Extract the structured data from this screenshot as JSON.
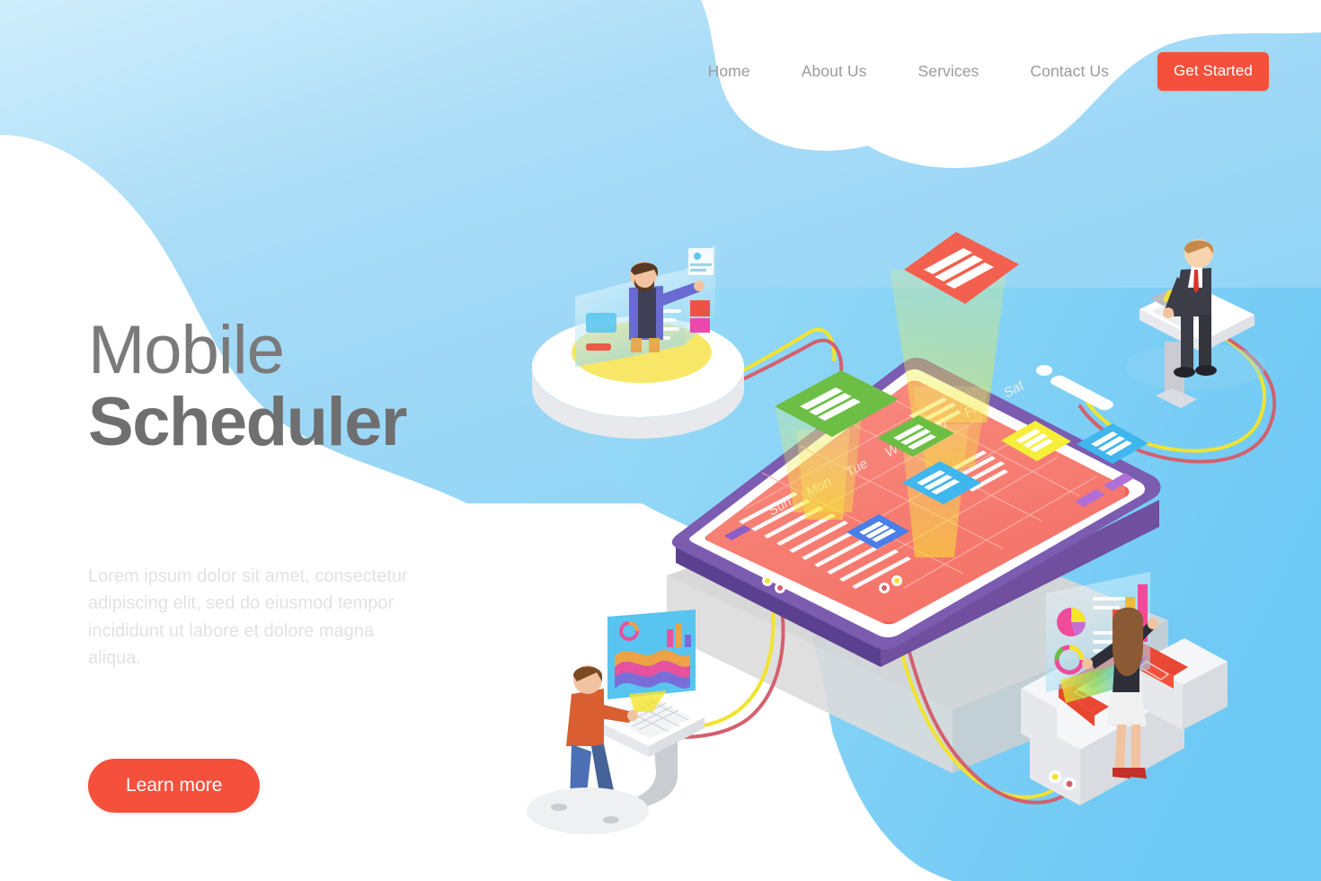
{
  "nav": {
    "links": [
      {
        "label": "Home"
      },
      {
        "label": "About Us"
      },
      {
        "label": "Services"
      },
      {
        "label": "Contact Us"
      }
    ],
    "cta_label": "Get Started",
    "cta_color": "#f4503c"
  },
  "hero": {
    "title_line1": "Mobile",
    "title_line2": "Scheduler",
    "paragraph": "Lorem ipsum dolor sit amet, consectetur adipiscing elit, sed do eiusmod tempor incididunt ut labore et dolore magna aliqua.",
    "cta_label": "Learn more",
    "cta_color": "#f4503c",
    "title_color": "#7a7a7a",
    "paragraph_color": "#e2e2e2"
  },
  "illustration": {
    "scene_name": "isometric-mobile-scheduler",
    "device": {
      "name": "smartphone",
      "frame_color": "#6f4f9e",
      "screen_color": "#f4604f",
      "screen_app": "calendar"
    },
    "calendar": {
      "day_labels": [
        "Sun",
        "Mon",
        "Tue",
        "Wen",
        "Thu",
        "Fri",
        "Sat"
      ],
      "event_cards": [
        {
          "color": "#6cbe45",
          "name": "green-event-card-large"
        },
        {
          "color": "#6cbe45",
          "name": "green-event-card-small"
        },
        {
          "color": "#3fb6ee",
          "name": "blue-event-card-center"
        },
        {
          "color": "#3fb6ee",
          "name": "blue-event-card-right"
        },
        {
          "color": "#4a7ee8",
          "name": "blue-event-card-bottom"
        },
        {
          "color": "#f7ee3a",
          "name": "yellow-event-card"
        }
      ],
      "floating_card": {
        "color": "#f4604f",
        "name": "red-notification-card"
      }
    },
    "background": {
      "blob_light": "#a8def8",
      "blob_mid": "#6cc8f5",
      "white": "#ffffff",
      "shadow": "#d4d4d4"
    },
    "characters": [
      {
        "name": "bearded-man-hologram",
        "position": "top-left",
        "shirt_color": "#6a6bd0",
        "vest_color": "#3f3f56",
        "platform_color": "#ffffff"
      },
      {
        "name": "businessman-podium",
        "position": "top-right",
        "suit_color": "#3d3d48",
        "tie_color": "#d9342b",
        "desk_color": "#ffffff"
      },
      {
        "name": "man-keyboard-monitor",
        "position": "bottom-left",
        "sweater_color": "#d95f33",
        "jeans_color": "#4d6fb5",
        "monitor_color": "#58c4f0"
      },
      {
        "name": "woman-dashboard-sofa",
        "position": "bottom-right",
        "top_color": "#2e2e38",
        "skirt_color": "#f0f0f0",
        "sofa_color": "#f4503c",
        "hair_color": "#8b5a35"
      }
    ],
    "cables": [
      {
        "color": "#f2e32f",
        "name": "yellow-cable"
      },
      {
        "color": "#d4606e",
        "name": "red-cable"
      }
    ],
    "light_beams": {
      "color": "#f7ee3a",
      "name": "projection-beam"
    }
  }
}
